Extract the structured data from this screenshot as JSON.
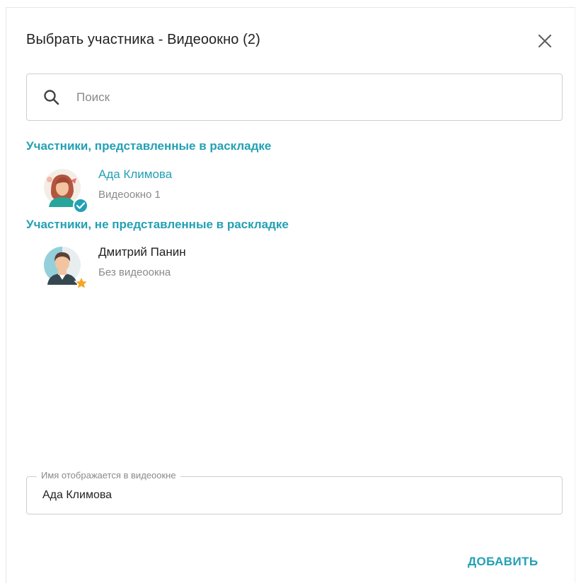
{
  "dialog": {
    "title": "Выбрать участника - Видеоокно (2)",
    "close_icon": "close-icon"
  },
  "search": {
    "placeholder": "Поиск",
    "value": "",
    "icon": "search-icon"
  },
  "sections": [
    {
      "heading": "Участники, представленные в раскладке",
      "participants": [
        {
          "name": "Ада Климова",
          "subtitle": "Видеоокно 1",
          "selected": true,
          "badge_icon": "check-badge-icon"
        }
      ]
    },
    {
      "heading": "Участники, не представленные в раскладке",
      "participants": [
        {
          "name": "Дмитрий Панин",
          "subtitle": "Без видеоокна",
          "selected": false,
          "badge_icon": "star-badge-icon"
        }
      ]
    }
  ],
  "display_name_field": {
    "label": "Имя отображается в видеоокне",
    "value": "Ада Климова"
  },
  "actions": {
    "add_label": "ДОБАВИТЬ"
  },
  "colors": {
    "accent": "#23a0b4",
    "text": "#212121",
    "muted": "#8a8a8a",
    "border": "#cfcfcf"
  }
}
